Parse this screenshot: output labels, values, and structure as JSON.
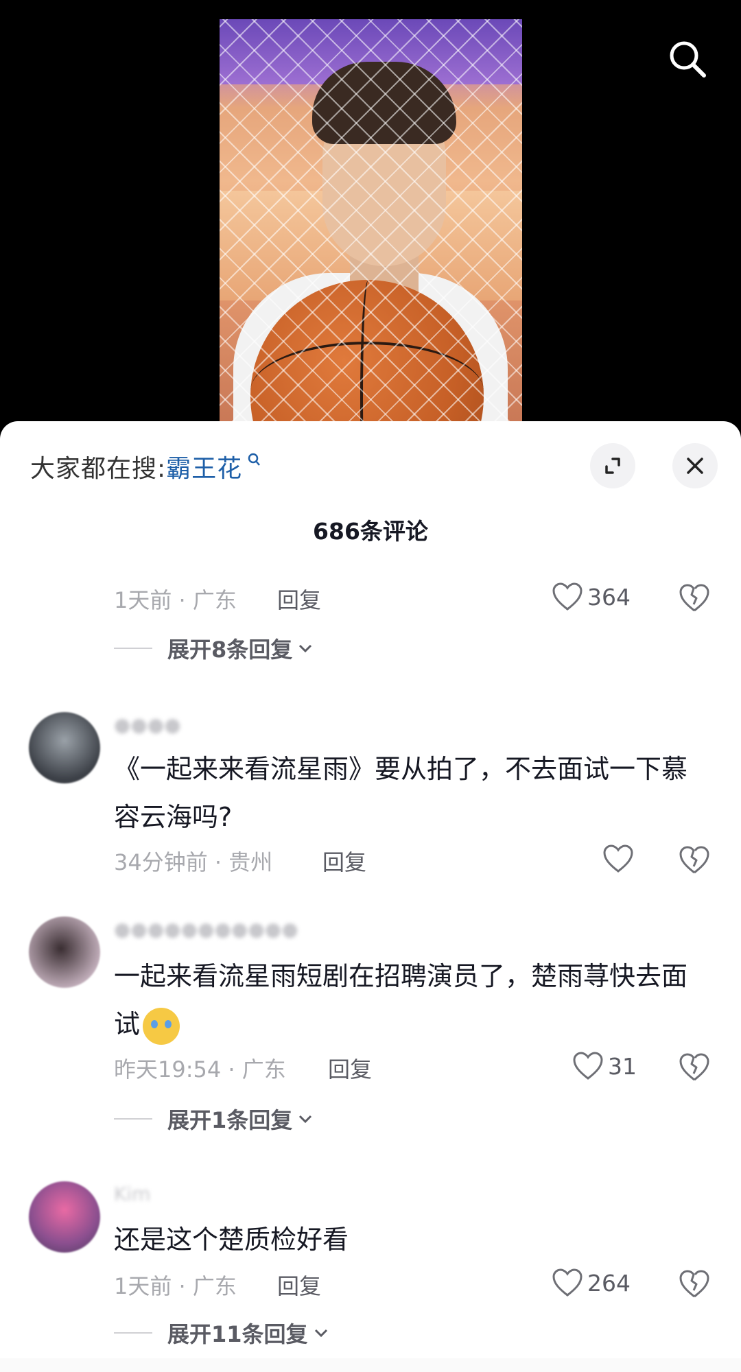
{
  "hot_search": {
    "prefix": "大家都在搜:",
    "keyword": "霸王花",
    "icon": "search-small-icon"
  },
  "sheet": {
    "title": "686条评论"
  },
  "top_reply": {
    "time_location": "1天前 · 广东",
    "reply_label": "回复",
    "likes": "364",
    "expand_label": "展开8条回复"
  },
  "comments": [
    {
      "username": "",
      "text": "《一起来来看流星雨》要从拍了，不去面试一下慕容云海吗?",
      "time_location": "34分钟前 · 贵州",
      "reply_label": "回复",
      "likes": ""
    },
    {
      "username": "",
      "text": "一起来看流星雨短剧在招聘演员了，楚雨荨快去面试",
      "emoji": "crying-laughing-emoji",
      "time_location": "昨天19:54 · 广东",
      "reply_label": "回复",
      "likes": "31",
      "expand_label": "展开1条回复"
    },
    {
      "username": "Kim",
      "text": "还是这个楚质检好看",
      "time_location": "1天前 · 广东",
      "reply_label": "回复",
      "likes": "264",
      "expand_label": "展开11条回复"
    }
  ],
  "colors": {
    "link_blue": "#1e5fa8",
    "meta_gray": "#a7a8ad",
    "text_dark": "#161823"
  }
}
